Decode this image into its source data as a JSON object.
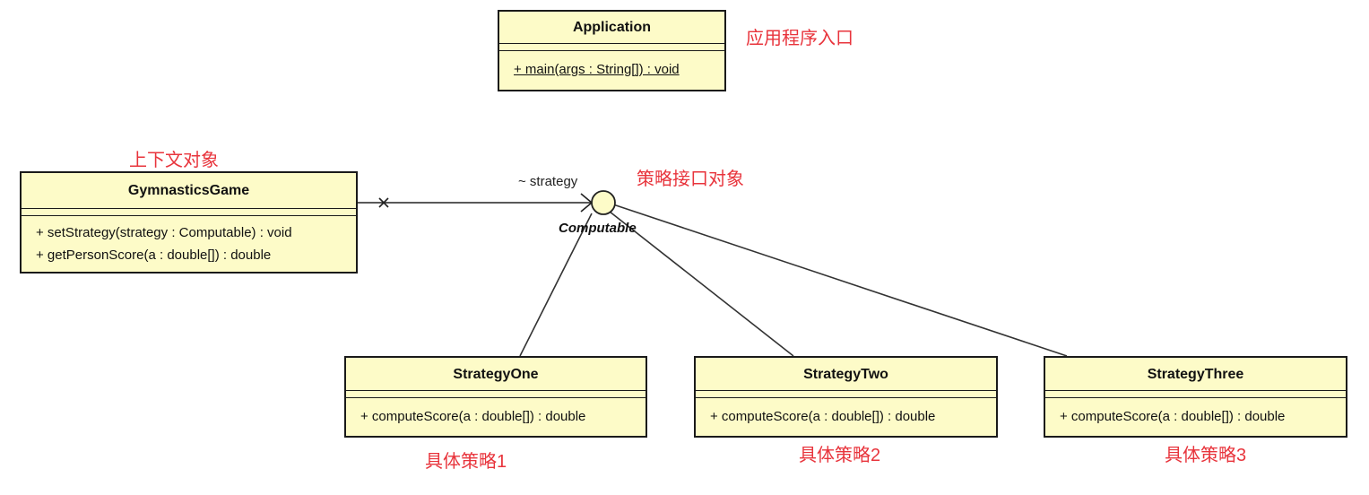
{
  "classes": {
    "application": {
      "name": "Application",
      "operations": [
        "+ main(args : String[]) : void"
      ]
    },
    "gymnastics": {
      "name": "GymnasticsGame",
      "operations": [
        "+ setStrategy(strategy : Computable) : void",
        "+ getPersonScore(a : double[]) : double"
      ]
    },
    "strategy_one": {
      "name": "StrategyOne",
      "operations": [
        "+ computeScore(a : double[]) : double"
      ]
    },
    "strategy_two": {
      "name": "StrategyTwo",
      "operations": [
        "+ computeScore(a : double[]) : double"
      ]
    },
    "strategy_three": {
      "name": "StrategyThree",
      "operations": [
        "+ computeScore(a : double[]) : double"
      ]
    }
  },
  "interface": {
    "name": "Computable"
  },
  "association": {
    "role": "~ strategy"
  },
  "notes": {
    "application": "应用程序入口",
    "context": "上下文对象",
    "interface": "策略接口对象",
    "strategy_one": "具体策略1",
    "strategy_two": "具体策略2",
    "strategy_three": "具体策略3"
  },
  "colors": {
    "class_fill": "#fdfbc8",
    "border": "#1a1a1a",
    "note": "#e8343c"
  }
}
